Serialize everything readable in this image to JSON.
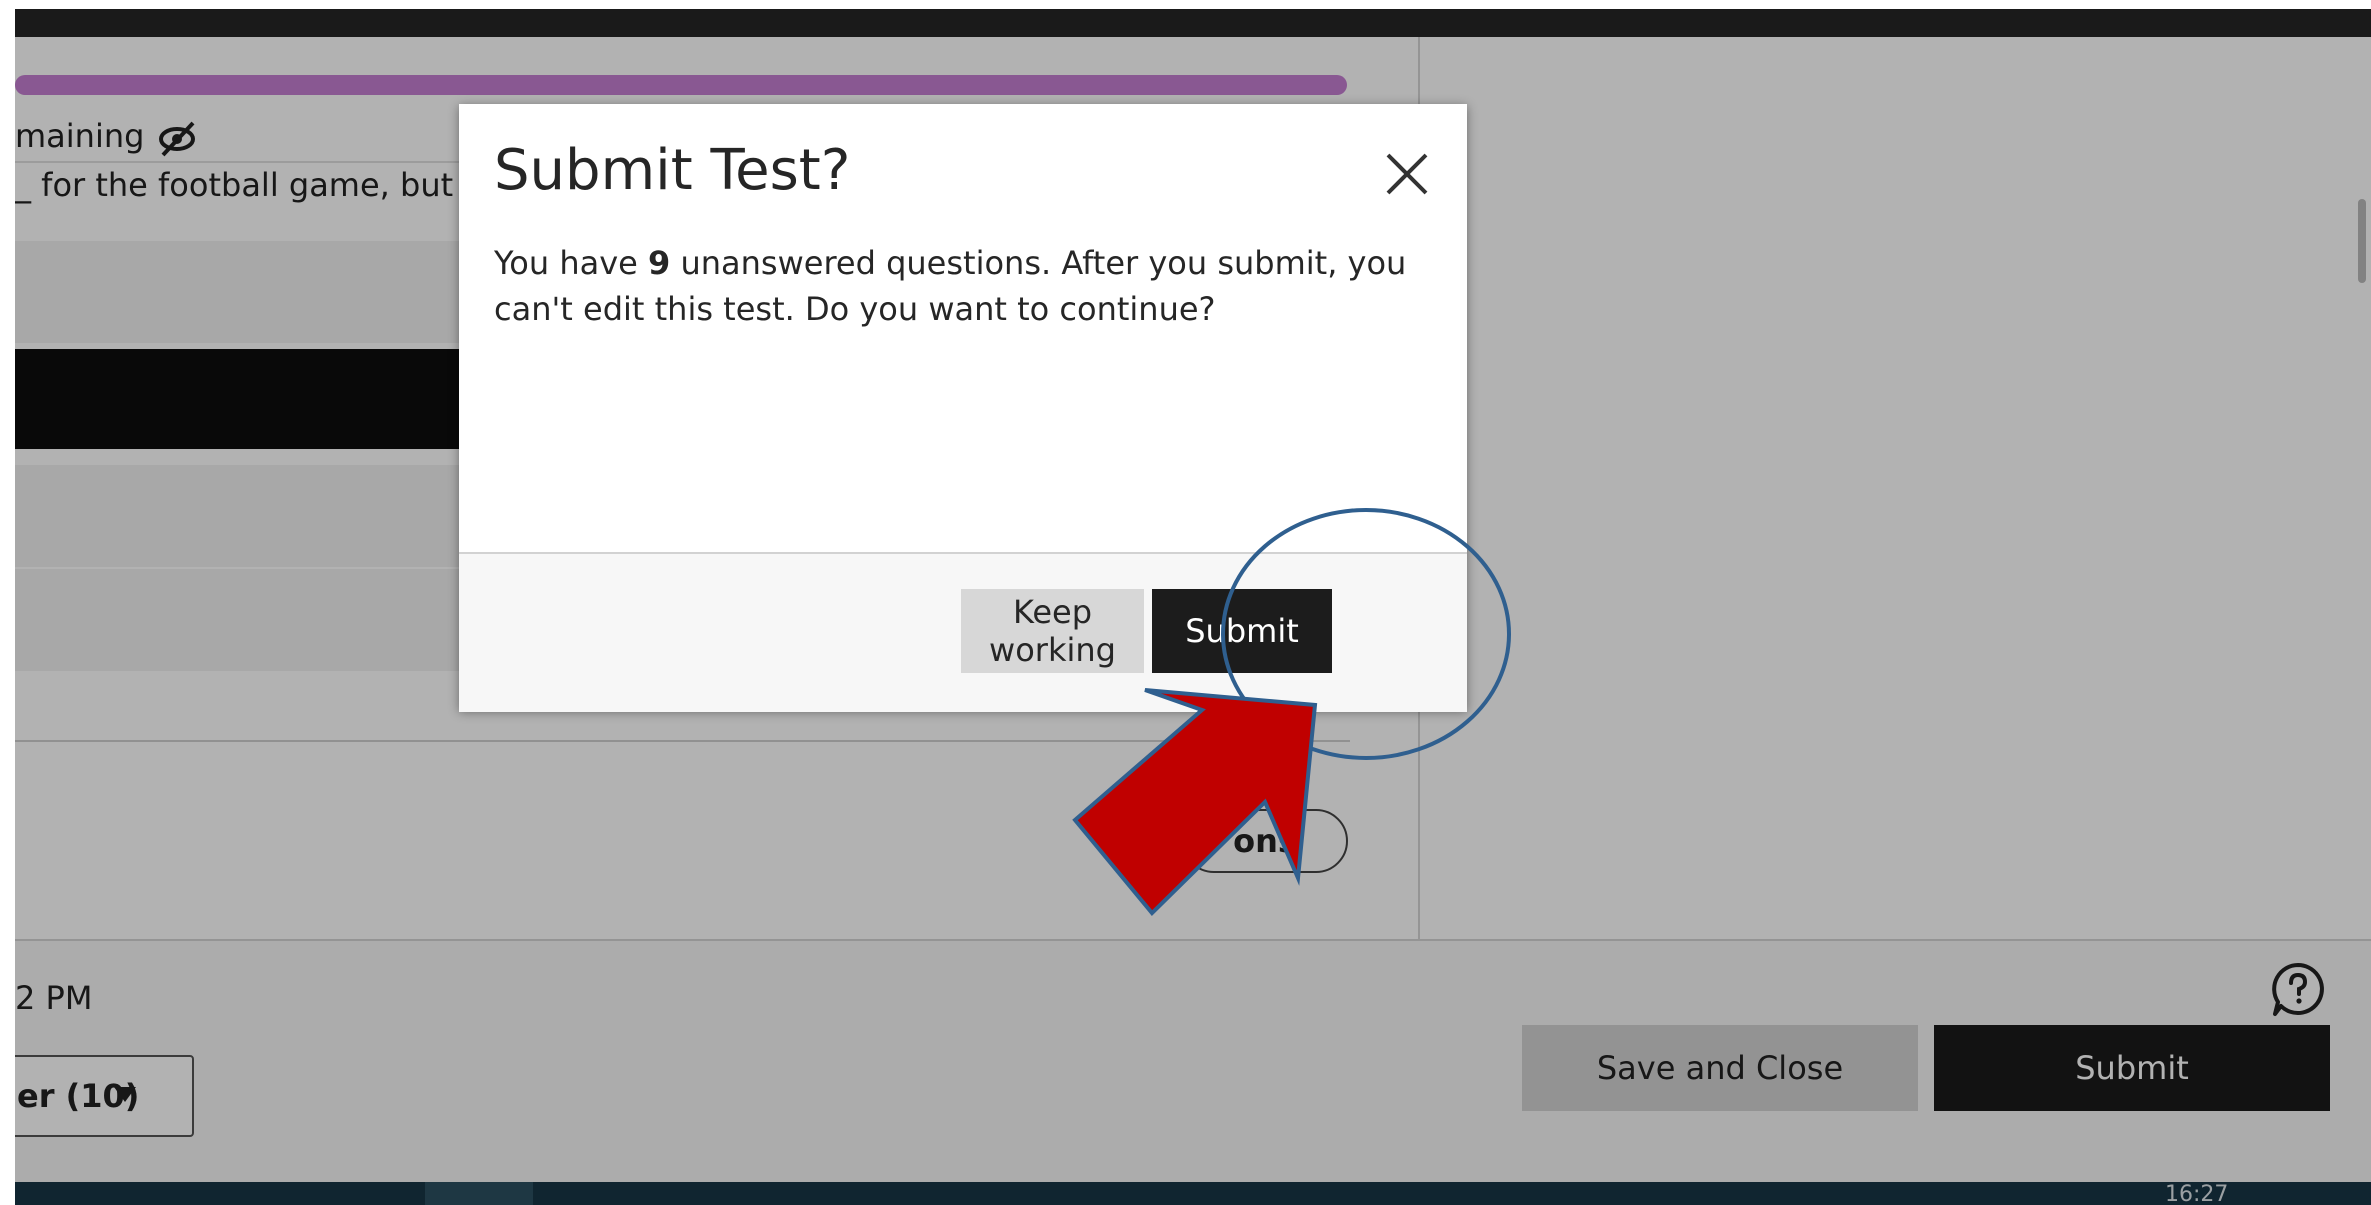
{
  "colors": {
    "overlay": "rgba(0,0,0,0.3)",
    "primary_button": "#1c1c1c",
    "secondary_button": "#d7d7d7",
    "progress_bar": "#c47ed1",
    "annotation_arrow": "#c00000",
    "annotation_circle": "#2f5f8f"
  },
  "question": {
    "remaining_fragment": "maining",
    "text_fragment": "_ for the football game, but it i",
    "options_fragment": "ons"
  },
  "footer": {
    "due_fragment": "2 PM",
    "page_select_value": "er (10)",
    "save_close_label": "Save and Close",
    "submit_label": "Submit"
  },
  "taskbar": {
    "clock": "16:27"
  },
  "modal": {
    "title": "Submit Test?",
    "body_prefix": "You have ",
    "unanswered_count": "9",
    "body_suffix": " unanswered questions. After you submit, you can't edit this test. Do you want to continue?",
    "keep_working_label": "Keep working",
    "submit_label": "Submit"
  },
  "icons": {
    "hidden": "eye-slash-icon",
    "close": "close-icon",
    "help": "help-icon",
    "dropdown": "caret-down-icon"
  }
}
